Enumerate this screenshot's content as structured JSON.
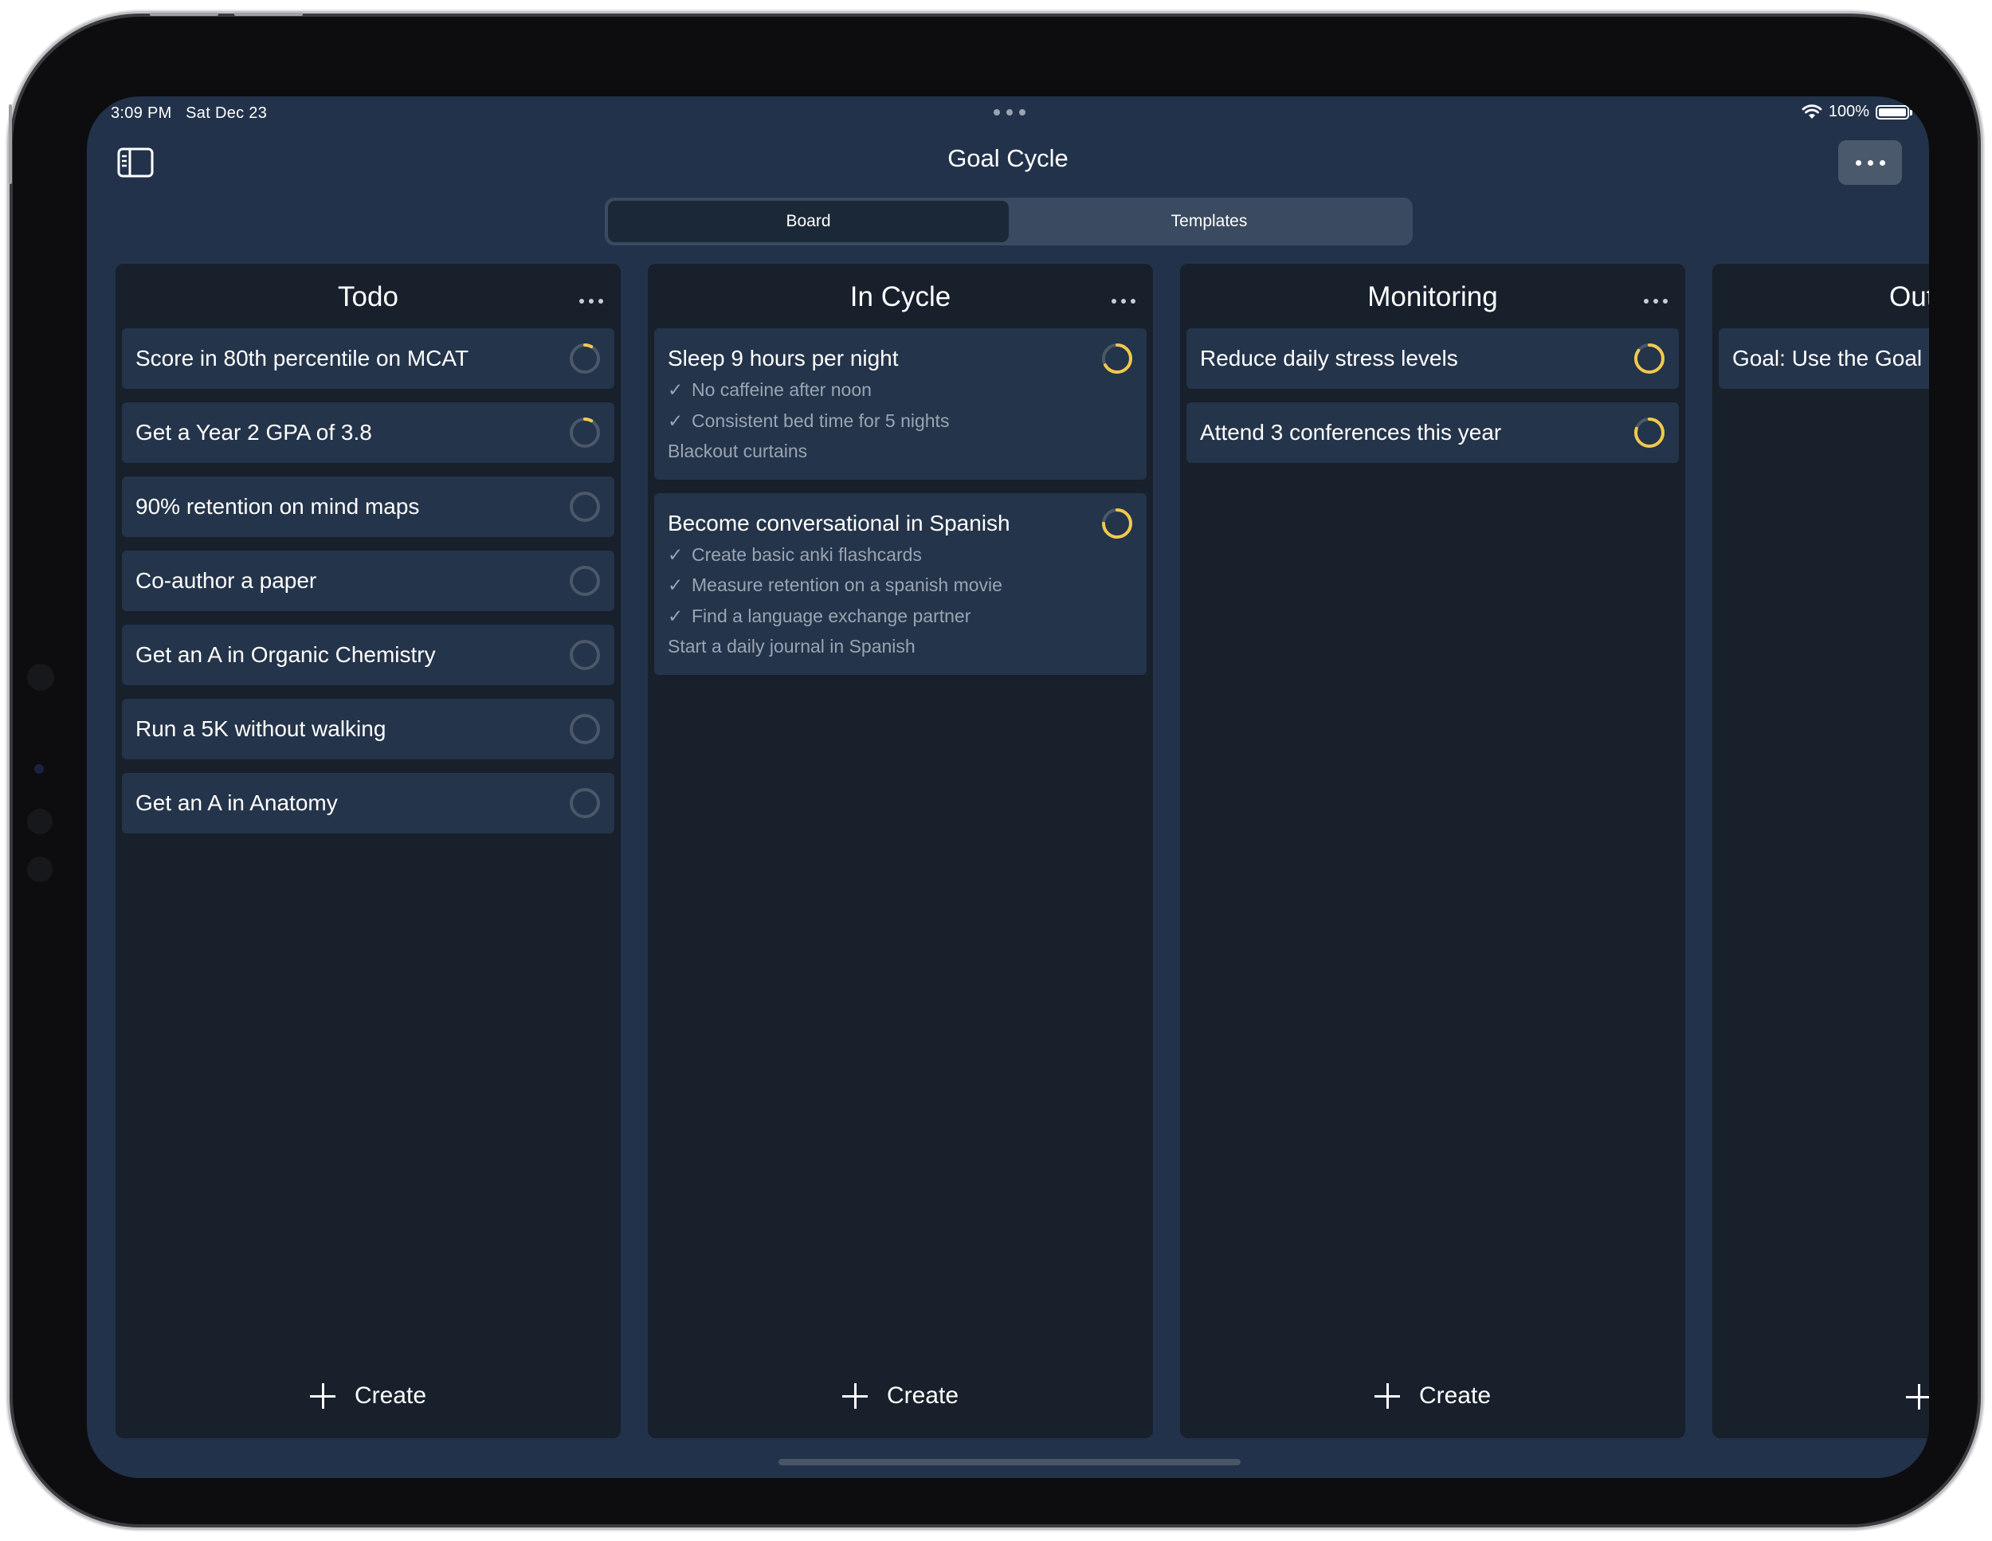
{
  "status_bar": {
    "time": "3:09 PM",
    "date": "Sat Dec 23",
    "battery": "100%"
  },
  "header": {
    "title": "Goal Cycle"
  },
  "tabs": [
    {
      "label": "Board",
      "active": true
    },
    {
      "label": "Templates",
      "active": false
    }
  ],
  "create_label": "Create",
  "columns": {
    "todo": {
      "title": "Todo",
      "cards": [
        {
          "title": "Score in 80th percentile on MCAT",
          "progress": 0.08
        },
        {
          "title": "Get a Year 2 GPA of 3.8",
          "progress": 0.08
        },
        {
          "title": "90% retention on mind maps",
          "progress": 0
        },
        {
          "title": "Co-author a paper",
          "progress": 0
        },
        {
          "title": "Get an A in Organic Chemistry",
          "progress": 0
        },
        {
          "title": "Run a 5K without walking",
          "progress": 0
        },
        {
          "title": "Get an A in Anatomy",
          "progress": 0
        }
      ]
    },
    "in_cycle": {
      "title": "In Cycle",
      "cards": [
        {
          "title": "Sleep 9 hours per night",
          "progress": 0.67,
          "subtasks": [
            {
              "text": "No caffeine after noon",
              "done": true
            },
            {
              "text": "Consistent bed time for 5 nights",
              "done": true
            },
            {
              "text": "Blackout curtains",
              "done": false
            }
          ]
        },
        {
          "title": "Become conversational in Spanish",
          "progress": 0.75,
          "subtasks": [
            {
              "text": "Create basic anki flashcards",
              "done": true
            },
            {
              "text": "Measure retention on a spanish movie",
              "done": true
            },
            {
              "text": "Find a language exchange partner",
              "done": true
            },
            {
              "text": "Start a daily journal in Spanish",
              "done": false
            }
          ]
        }
      ]
    },
    "monitoring": {
      "title": "Monitoring",
      "cards": [
        {
          "title": "Reduce daily stress levels",
          "progress": 0.85
        },
        {
          "title": "Attend 3 conferences this year",
          "progress": 0.8
        }
      ]
    },
    "outcome": {
      "title": "Out",
      "cards": [
        {
          "title": "Goal: Use the Goal C",
          "progress": 0
        }
      ]
    }
  },
  "colors": {
    "ring_track": "#4b5868",
    "ring_progress": "#f2c94c",
    "accent_bg": "#22324a"
  }
}
